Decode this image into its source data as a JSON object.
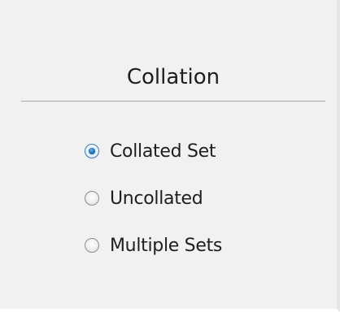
{
  "collation": {
    "title": "Collation",
    "options": [
      {
        "label": "Collated Set",
        "selected": true
      },
      {
        "label": "Uncollated",
        "selected": false
      },
      {
        "label": "Multiple Sets",
        "selected": false
      }
    ]
  }
}
